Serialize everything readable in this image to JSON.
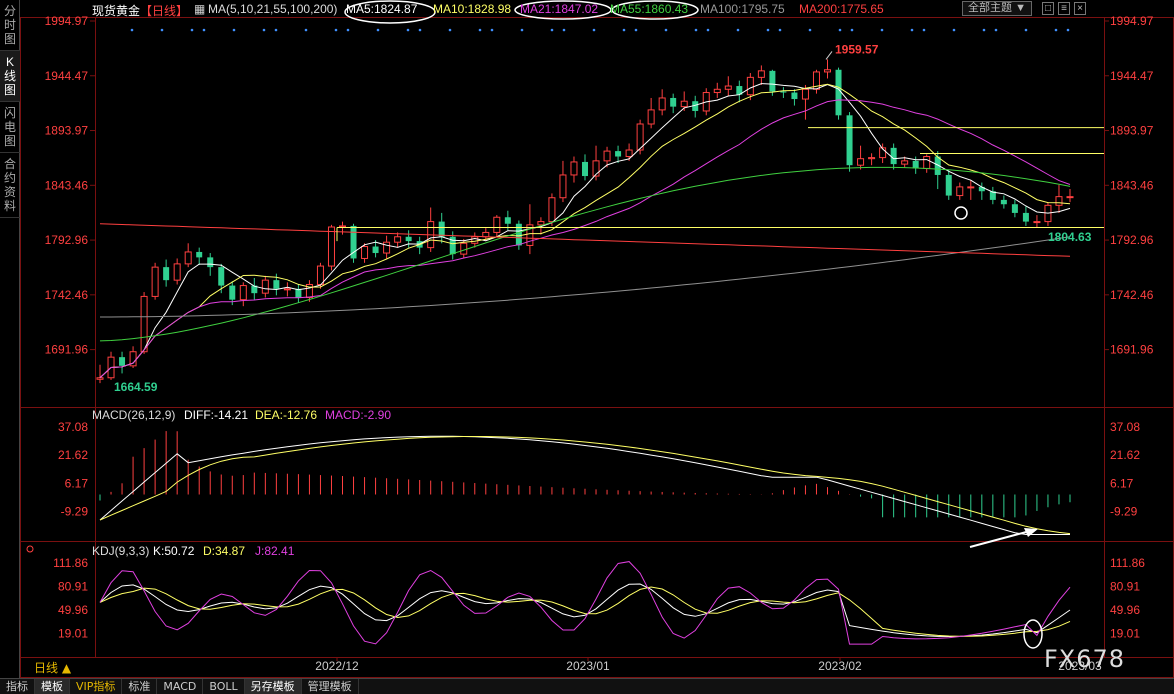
{
  "side_tabs": [
    {
      "label": "分时图",
      "active": false
    },
    {
      "label": "K线图",
      "active": true
    },
    {
      "label": "闪电图",
      "active": false
    },
    {
      "label": "合约资料",
      "active": false
    }
  ],
  "header": {
    "instrument": "现货黄金",
    "period": "【日线】",
    "ma_prefix": "MA(5,10,21,55,100,200)",
    "ma5": "MA5:1824.87",
    "ma10": "MA10:1828.98",
    "ma21": "MA21:1847.02",
    "ma55": "MA55:1860.43",
    "ma100": "MA100:1795.75",
    "ma200": "MA200:1775.65",
    "topic_button": "全部主题 ▼",
    "win_buttons": [
      "□",
      "≡",
      "×"
    ]
  },
  "macd_label": {
    "prefix": "MACD(26,12,9)",
    "diff": "DIFF:-14.21",
    "dea": "DEA:-12.76",
    "macd": "MACD:-2.90"
  },
  "kdj_label": {
    "prefix": "KDJ(9,3,3)",
    "k": "K:50.72",
    "d": "D:34.87",
    "j": "J:82.41"
  },
  "price_ticks": [
    "1994.97",
    "1944.47",
    "1893.97",
    "1843.46",
    "1792.96",
    "1742.46",
    "1691.96"
  ],
  "macd_ticks": [
    "37.08",
    "21.62",
    "6.17",
    "-9.29"
  ],
  "kdj_ticks": [
    "111.86",
    "80.91",
    "49.96",
    "19.01"
  ],
  "date_ticks": [
    "2022/12",
    "2023/01",
    "2023/02",
    "2023/03"
  ],
  "annotations": {
    "high_label": "1959.57",
    "low_label": "1664.59",
    "recent_low_label": "1804.63"
  },
  "period_indicator": "日线 ▲",
  "bottom_tabs": [
    {
      "label": "指标",
      "active": false,
      "vip": false
    },
    {
      "label": "模板",
      "active": true,
      "vip": false
    },
    {
      "label": "VIP指标",
      "active": false,
      "vip": true
    },
    {
      "label": "标准",
      "active": false,
      "vip": false
    },
    {
      "label": "MACD",
      "active": false,
      "vip": false
    },
    {
      "label": "BOLL",
      "active": false,
      "vip": false
    },
    {
      "label": "另存模板",
      "active": true,
      "vip": false
    },
    {
      "label": "管理模板",
      "active": false,
      "vip": false
    }
  ],
  "watermark": "FX678",
  "colors": {
    "up": "#ff4040",
    "down": "#30d090",
    "ma5": "#ffffff",
    "ma10": "#ffff66",
    "ma21": "#e040e0",
    "ma55": "#40d040",
    "ma100": "#909090",
    "ma200": "#ff4040",
    "axis_text": "#ff4040",
    "grid": "#7a1010"
  },
  "chart_data": {
    "type": "candlestick",
    "price_axis": {
      "ticks": [
        1994.97,
        1944.47,
        1893.97,
        1843.46,
        1792.96,
        1742.46,
        1691.96
      ]
    },
    "candles": [
      [
        1664.6,
        1666,
        1661,
        1678
      ],
      [
        1666,
        1685,
        1664,
        1690
      ],
      [
        1685,
        1677,
        1670,
        1690
      ],
      [
        1677,
        1690,
        1675,
        1695
      ],
      [
        1690,
        1741,
        1688,
        1745
      ],
      [
        1741,
        1768,
        1738,
        1772
      ],
      [
        1768,
        1756,
        1750,
        1775
      ],
      [
        1756,
        1771,
        1752,
        1776
      ],
      [
        1771,
        1782,
        1768,
        1790
      ],
      [
        1782,
        1777,
        1770,
        1786
      ],
      [
        1777,
        1768,
        1760,
        1781
      ],
      [
        1768,
        1751,
        1744,
        1771
      ],
      [
        1751,
        1738,
        1733,
        1755
      ],
      [
        1738,
        1751,
        1732,
        1754
      ],
      [
        1751,
        1744,
        1738,
        1758
      ],
      [
        1744,
        1756,
        1740,
        1760
      ],
      [
        1756,
        1748,
        1742,
        1762
      ],
      [
        1748,
        1748,
        1741,
        1754
      ],
      [
        1748,
        1740,
        1735,
        1752
      ],
      [
        1740,
        1752,
        1736,
        1756
      ],
      [
        1752,
        1769,
        1748,
        1772
      ],
      [
        1769,
        1805,
        1765,
        1807
      ],
      [
        1805,
        1806,
        1798,
        1810
      ],
      [
        1806,
        1776,
        1772,
        1808
      ],
      [
        1776,
        1787,
        1772,
        1790
      ],
      [
        1787,
        1781,
        1777,
        1793
      ],
      [
        1781,
        1791,
        1776,
        1797
      ],
      [
        1791,
        1796,
        1786,
        1800
      ],
      [
        1796,
        1792,
        1786,
        1802
      ],
      [
        1792,
        1786,
        1780,
        1796
      ],
      [
        1786,
        1810,
        1782,
        1823
      ],
      [
        1810,
        1796,
        1790,
        1818
      ],
      [
        1796,
        1780,
        1775,
        1801
      ],
      [
        1780,
        1790,
        1776,
        1794
      ],
      [
        1790,
        1796,
        1786,
        1800
      ],
      [
        1796,
        1800,
        1792,
        1804
      ],
      [
        1800,
        1814,
        1796,
        1816
      ],
      [
        1814,
        1808,
        1802,
        1820
      ],
      [
        1808,
        1788,
        1784,
        1811
      ],
      [
        1788,
        1807,
        1780,
        1826
      ],
      [
        1807,
        1810,
        1798,
        1814
      ],
      [
        1810,
        1832,
        1806,
        1836
      ],
      [
        1832,
        1853,
        1828,
        1866
      ],
      [
        1853,
        1865,
        1846,
        1870
      ],
      [
        1865,
        1852,
        1848,
        1872
      ],
      [
        1852,
        1866,
        1848,
        1880
      ],
      [
        1866,
        1875,
        1860,
        1879
      ],
      [
        1875,
        1870,
        1864,
        1880
      ],
      [
        1870,
        1876,
        1866,
        1882
      ],
      [
        1876,
        1900,
        1872,
        1904
      ],
      [
        1900,
        1913,
        1896,
        1924
      ],
      [
        1913,
        1924,
        1908,
        1932
      ],
      [
        1924,
        1916,
        1910,
        1928
      ],
      [
        1916,
        1921,
        1912,
        1930
      ],
      [
        1921,
        1912,
        1906,
        1926
      ],
      [
        1912,
        1929,
        1908,
        1933
      ],
      [
        1929,
        1932,
        1924,
        1938
      ],
      [
        1932,
        1935,
        1926,
        1944
      ],
      [
        1935,
        1927,
        1920,
        1940
      ],
      [
        1927,
        1943,
        1922,
        1947
      ],
      [
        1943,
        1949,
        1936,
        1954
      ],
      [
        1949,
        1930,
        1926,
        1950
      ],
      [
        1930,
        1929,
        1924,
        1934
      ],
      [
        1929,
        1923,
        1917,
        1932
      ],
      [
        1923,
        1932,
        1904,
        1936
      ],
      [
        1932,
        1948,
        1928,
        1950
      ],
      [
        1948,
        1950,
        1942,
        1959.6
      ],
      [
        1950,
        1908,
        1904,
        1952
      ],
      [
        1908,
        1862,
        1856,
        1911
      ],
      [
        1862,
        1868,
        1858,
        1880
      ],
      [
        1868,
        1869,
        1862,
        1873
      ],
      [
        1869,
        1878,
        1864,
        1882
      ],
      [
        1878,
        1863,
        1858,
        1882
      ],
      [
        1863,
        1866,
        1860,
        1870
      ],
      [
        1866,
        1859,
        1854,
        1870
      ],
      [
        1859,
        1870,
        1855,
        1872
      ],
      [
        1870,
        1853,
        1840,
        1875
      ],
      [
        1853,
        1834,
        1830,
        1858
      ],
      [
        1834,
        1842,
        1830,
        1846
      ],
      [
        1842,
        1842,
        1830,
        1848
      ],
      [
        1842,
        1838,
        1830,
        1846
      ],
      [
        1838,
        1830,
        1826,
        1842
      ],
      [
        1830,
        1826,
        1822,
        1834
      ],
      [
        1826,
        1818,
        1814,
        1830
      ],
      [
        1818,
        1810,
        1806,
        1824
      ],
      [
        1810,
        1810,
        1804.6,
        1816
      ],
      [
        1810,
        1825,
        1806,
        1828
      ],
      [
        1825,
        1833,
        1818,
        1844
      ],
      [
        1833,
        1833,
        1828,
        1840
      ]
    ],
    "moving_averages": [
      {
        "name": "MA5",
        "value": 1824.87
      },
      {
        "name": "MA10",
        "value": 1828.98
      },
      {
        "name": "MA21",
        "value": 1847.02
      },
      {
        "name": "MA55",
        "value": 1860.43
      },
      {
        "name": "MA100",
        "value": 1795.75
      },
      {
        "name": "MA200",
        "value": 1775.65
      }
    ],
    "horizontal_levels": [
      1896.6,
      1872.8,
      1804.6,
      1778.1
    ],
    "macd": {
      "diff": -14.21,
      "dea": -12.76,
      "macd": -2.9,
      "ticks": [
        37.08,
        21.62,
        6.17,
        -9.29
      ]
    },
    "kdj": {
      "k": 50.72,
      "d": 34.87,
      "j": 82.41,
      "ticks": [
        111.86,
        80.91,
        49.96,
        19.01
      ]
    },
    "x_ticks": [
      "2022/12",
      "2023/01",
      "2023/02",
      "2023/03"
    ]
  }
}
